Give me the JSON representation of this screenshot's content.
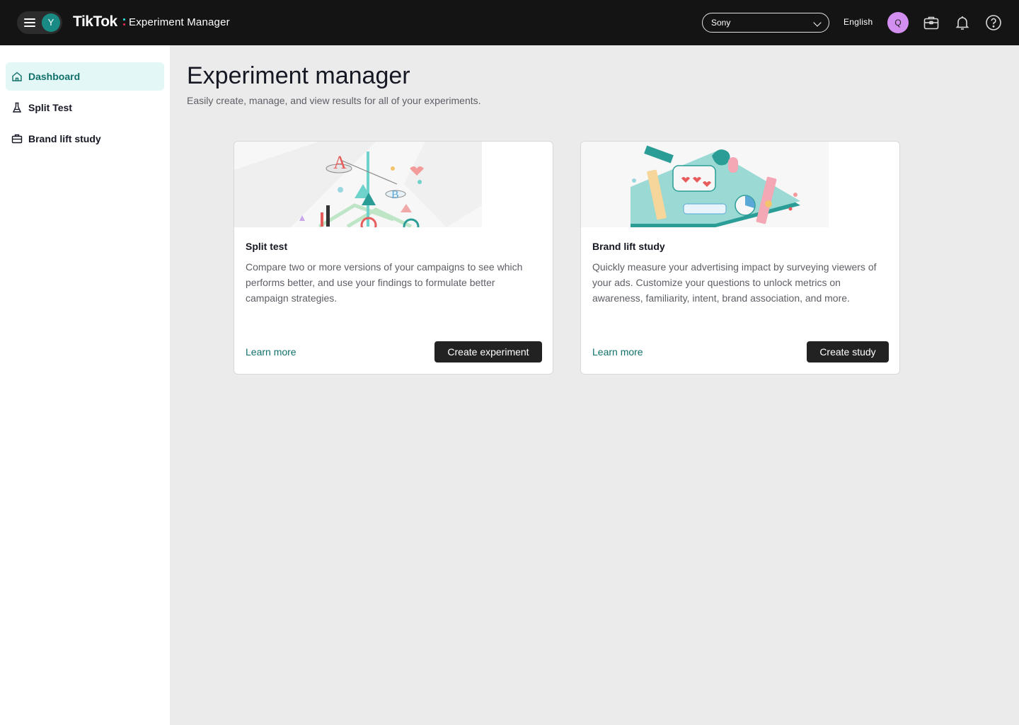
{
  "header": {
    "brand": "TikTok",
    "product": "Experiment Manager",
    "workspace_avatar": "Y",
    "account_select": "Sony",
    "language": "English",
    "user_avatar": "Q",
    "icons": [
      "menu-icon",
      "briefcase-icon",
      "bell-icon",
      "help-icon"
    ]
  },
  "sidebar": {
    "items": [
      {
        "label": "Dashboard",
        "icon": "home-icon",
        "active": true
      },
      {
        "label": "Split Test",
        "icon": "flask-icon",
        "active": false
      },
      {
        "label": "Brand lift study",
        "icon": "briefcase-icon",
        "active": false
      }
    ]
  },
  "main": {
    "title": "Experiment manager",
    "subtitle": "Easily create, manage, and view results for all of your experiments.",
    "cards": [
      {
        "title": "Split test",
        "description": "Compare two or more versions of your campaigns to see which performs better, and use your findings to formulate better campaign strategies.",
        "learn_more": "Learn more",
        "action": "Create experiment"
      },
      {
        "title": "Brand lift study",
        "description": "Quickly measure your advertising impact by surveying viewers of your ads. Customize your questions to unlock metrics on awareness, familiarity, intent, brand association, and more.",
        "learn_more": "Learn more",
        "action": "Create study"
      }
    ]
  },
  "colors": {
    "topbar": "#141414",
    "accent": "#10716b",
    "active_nav_bg": "#e3f7f6",
    "page_bg": "#ebebeb"
  }
}
